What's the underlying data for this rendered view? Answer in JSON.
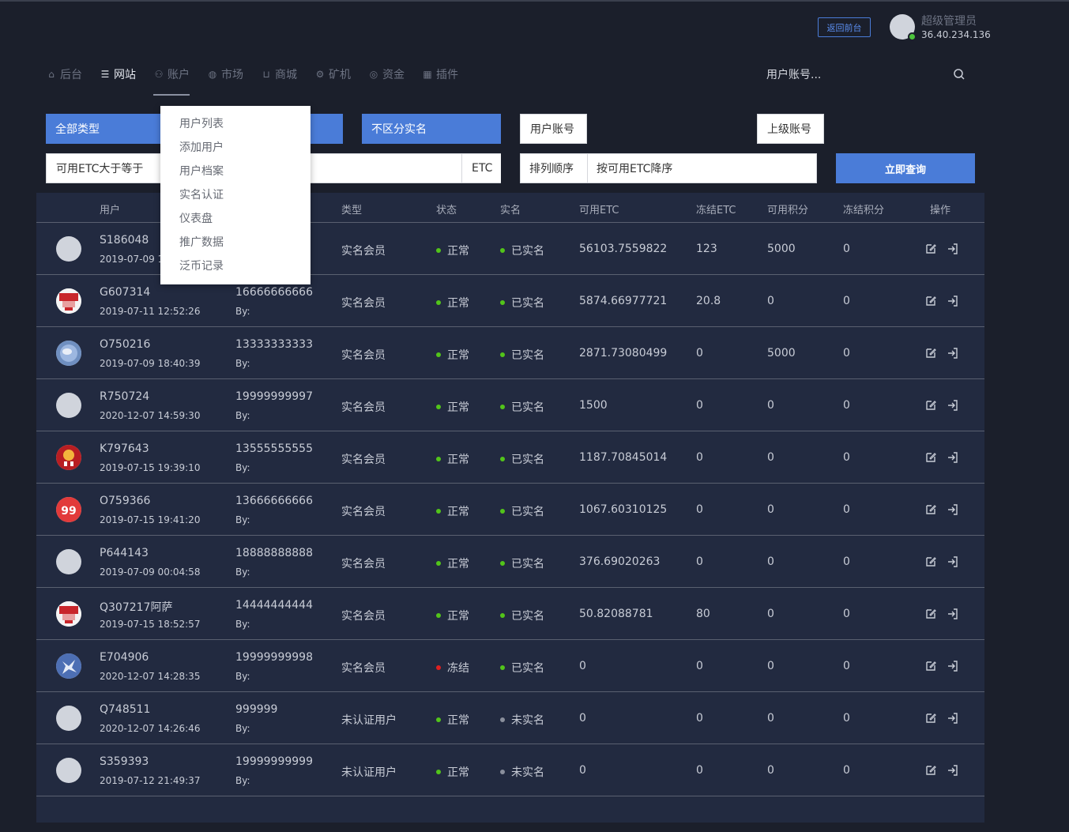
{
  "header": {
    "front_button": "返回前台",
    "admin_name": "超级管理员",
    "admin_ip": "36.40.234.136"
  },
  "nav": [
    {
      "label": "后台",
      "icon": "home-icon"
    },
    {
      "label": "网站",
      "icon": "list-icon"
    },
    {
      "label": "账户",
      "icon": "user-icon"
    },
    {
      "label": "市场",
      "icon": "globe-icon"
    },
    {
      "label": "商城",
      "icon": "cart-icon"
    },
    {
      "label": "矿机",
      "icon": "gear-icon"
    },
    {
      "label": "资金",
      "icon": "coin-icon"
    },
    {
      "label": "插件",
      "icon": "grid-icon"
    }
  ],
  "search": {
    "label": "用户账号..."
  },
  "dropdown": [
    "用户列表",
    "添加用户",
    "用户档案",
    "实名认证",
    "仪表盘",
    "推广数据",
    "泛币记录"
  ],
  "filters": {
    "type": "全部类型",
    "realname": "不区分实名",
    "user_account": "用户账号",
    "parent_account": "上级账号",
    "etc_gte": "可用ETC大于等于",
    "etc_unit": "ETC",
    "sort_label": "排列顺序",
    "sort_value": "按可用ETC降序",
    "query_button": "立即查询"
  },
  "table": {
    "headers": [
      "用户",
      "类型",
      "状态",
      "实名",
      "可用ETC",
      "冻结ETC",
      "可用积分",
      "冻结积分",
      "操作"
    ],
    "rows": [
      {
        "id": "S186048",
        "date": "2019-07-09 1",
        "phone": "",
        "by": "",
        "type": "实名会员",
        "status": "正常",
        "realname": "已实名",
        "etc": "56103.7559822",
        "frozen_etc": "123",
        "points": "5000",
        "frozen_points": "0",
        "avatar": "plain"
      },
      {
        "id": "G607314",
        "date": "2019-07-11 12:52:26",
        "phone": "16666666666",
        "by": "By:",
        "type": "实名会员",
        "status": "正常",
        "realname": "已实名",
        "etc": "5874.66977721",
        "frozen_etc": "20.8",
        "points": "0",
        "frozen_points": "0",
        "avatar": "red-pattern"
      },
      {
        "id": "O750216",
        "date": "2019-07-09 18:40:39",
        "phone": "13333333333",
        "by": "By:",
        "type": "实名会员",
        "status": "正常",
        "realname": "已实名",
        "etc": "2871.73080499",
        "frozen_etc": "0",
        "points": "5000",
        "frozen_points": "0",
        "avatar": "blue-globe"
      },
      {
        "id": "R750724",
        "date": "2020-12-07 14:59:30",
        "phone": "19999999997",
        "by": "By:",
        "type": "实名会员",
        "status": "正常",
        "realname": "已实名",
        "etc": "1500",
        "frozen_etc": "0",
        "points": "0",
        "frozen_points": "0",
        "avatar": "plain"
      },
      {
        "id": "K797643",
        "date": "2019-07-15 19:39:10",
        "phone": "13555555555",
        "by": "By:",
        "type": "实名会员",
        "status": "正常",
        "realname": "已实名",
        "etc": "1187.70845014",
        "frozen_etc": "0",
        "points": "0",
        "frozen_points": "0",
        "avatar": "red-lantern"
      },
      {
        "id": "O759366",
        "date": "2019-07-15 19:41:20",
        "phone": "13666666666",
        "by": "By:",
        "type": "实名会员",
        "status": "正常",
        "realname": "已实名",
        "etc": "1067.60310125",
        "frozen_etc": "0",
        "points": "0",
        "frozen_points": "0",
        "avatar": "red-99"
      },
      {
        "id": "P644143",
        "date": "2019-07-09 00:04:58",
        "phone": "18888888888",
        "by": "By:",
        "type": "实名会员",
        "status": "正常",
        "realname": "已实名",
        "etc": "376.69020263",
        "frozen_etc": "0",
        "points": "0",
        "frozen_points": "0",
        "avatar": "plain"
      },
      {
        "id": "Q307217阿萨",
        "date": "2019-07-15 18:52:57",
        "phone": "14444444444",
        "by": "By:",
        "type": "实名会员",
        "status": "正常",
        "realname": "已实名",
        "etc": "50.82088781",
        "frozen_etc": "80",
        "points": "0",
        "frozen_points": "0",
        "avatar": "red-pattern"
      },
      {
        "id": "E704906",
        "date": "2020-12-07 14:28:35",
        "phone": "19999999998",
        "by": "By:",
        "type": "实名会员",
        "status": "冻结",
        "realname": "已实名",
        "etc": "0",
        "frozen_etc": "0",
        "points": "0",
        "frozen_points": "0",
        "avatar": "blue-splash"
      },
      {
        "id": "Q748511",
        "date": "2020-12-07 14:26:46",
        "phone": "999999",
        "by": "By:",
        "type": "未认证用户",
        "status": "正常",
        "realname": "未实名",
        "etc": "0",
        "frozen_etc": "0",
        "points": "0",
        "frozen_points": "0",
        "avatar": "plain"
      },
      {
        "id": "S359393",
        "date": "2019-07-12 21:49:37",
        "phone": "19999999999",
        "by": "By:",
        "type": "未认证用户",
        "status": "正常",
        "realname": "未实名",
        "etc": "0",
        "frozen_etc": "0",
        "points": "0",
        "frozen_points": "0",
        "avatar": "plain"
      }
    ]
  },
  "colors": {
    "accent": "#4a7cd8",
    "ok": "#52c41a",
    "frozen": "#e02020",
    "unverified": "#8a8f9c"
  }
}
